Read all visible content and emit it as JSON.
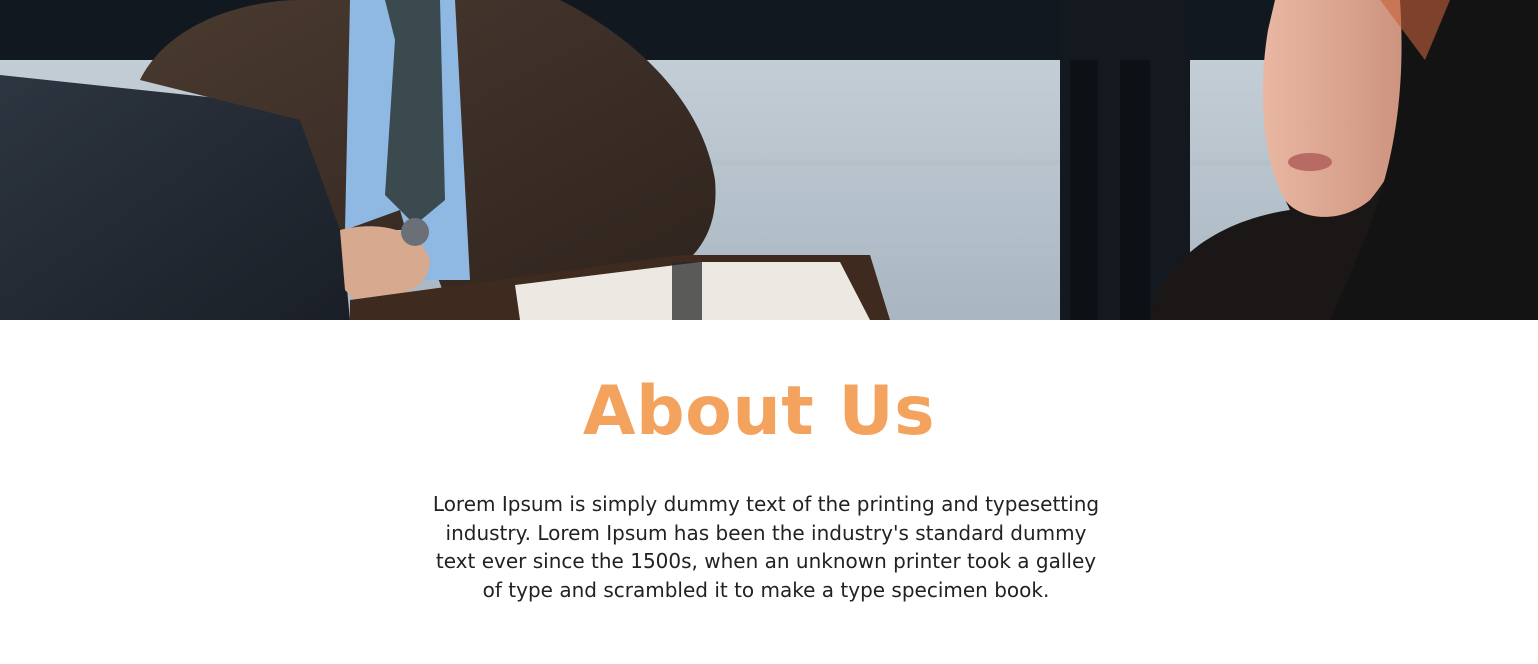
{
  "hero": {
    "image_description_icon": "office-meeting-photo"
  },
  "about": {
    "title": "About Us",
    "body": "Lorem Ipsum is simply dummy text of the printing and typesetting industry. Lorem Ipsum has been the industry's standard dummy text ever since the 1500s, when an unknown printer took a galley of type and scrambled it to make a type specimen book."
  },
  "colors": {
    "accent": "#f4a35f",
    "body_text": "#222222",
    "background": "#ffffff"
  }
}
